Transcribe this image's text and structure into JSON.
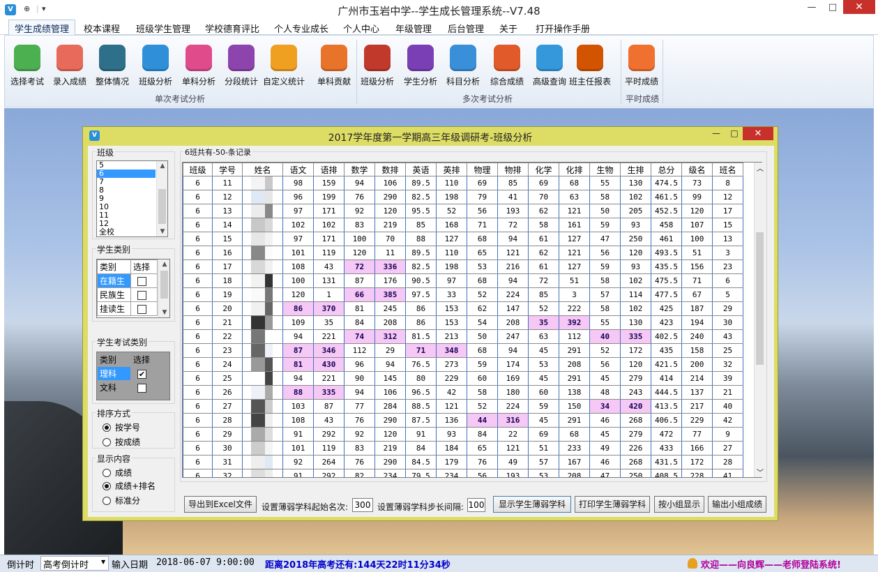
{
  "app": {
    "title": "广州市玉岩中学--学生成长管理系统--V7.48",
    "minimize": "—",
    "maximize": "□",
    "close": "✕",
    "quick_access": [
      "⊕",
      "▾"
    ]
  },
  "menu": [
    "学生成绩管理",
    "校本课程",
    "班级学生管理",
    "学校德育评比",
    "个人专业成长",
    "个人中心",
    "年级管理",
    "后台管理",
    "关于",
    "打开操作手册"
  ],
  "ribbon": {
    "groups": [
      "单次考试分析",
      "多次考试分析",
      "平时成绩"
    ],
    "buttons": [
      {
        "label": "选择考试",
        "color": "#4caf50",
        "icon": "download-icon"
      },
      {
        "label": "录入成绩",
        "color": "#e86a5a",
        "icon": "notepad-icon"
      },
      {
        "label": "整体情况",
        "color": "#2e6f8a",
        "icon": "layers-icon"
      },
      {
        "label": "班级分析",
        "color": "#2f8fd8",
        "icon": "line-chart-icon"
      },
      {
        "label": "单科分析",
        "color": "#e04b8b",
        "icon": "bookmark-icon"
      },
      {
        "label": "分段统计",
        "color": "#8e44ad",
        "icon": "palette-icon"
      },
      {
        "label": "自定义统计",
        "color": "#f0a020",
        "icon": "shield-icon"
      },
      {
        "label": "单科贡献",
        "color": "#e8732a",
        "icon": "compass-icon"
      },
      {
        "label": "班级分析",
        "color": "#c0392b",
        "icon": "book-icon"
      },
      {
        "label": "学生分析",
        "color": "#7b3fb5",
        "icon": "bar-chart-icon"
      },
      {
        "label": "科目分析",
        "color": "#3a8fd9",
        "icon": "list-icon"
      },
      {
        "label": "综合成绩",
        "color": "#e05a2a",
        "icon": "report-icon"
      },
      {
        "label": "高级查询",
        "color": "#3498db",
        "icon": "card-icon"
      },
      {
        "label": "班主任报表",
        "color": "#d35400",
        "icon": "briefcase-icon"
      },
      {
        "label": "平时成绩",
        "color": "#f07030",
        "icon": "document-icon"
      }
    ]
  },
  "window": {
    "title": "2017学年度第一学期高三年级调研考-班级分析",
    "record_info": "6班共有-50-条记录",
    "class_group": {
      "label": "班级",
      "items": [
        "5",
        "6",
        "7",
        "8",
        "9",
        "10",
        "11",
        "12",
        "全校"
      ],
      "selected": "6"
    },
    "student_type": {
      "label": "学生类别",
      "headers": [
        "类别",
        "选择"
      ],
      "rows": [
        {
          "name": "在籍生",
          "checked": false
        },
        {
          "name": "民族生",
          "checked": false
        },
        {
          "name": "挂读生",
          "checked": false
        }
      ]
    },
    "exam_type": {
      "label": "学生考试类别",
      "headers": [
        "类别",
        "选择"
      ],
      "rows": [
        {
          "name": "理科",
          "checked": true
        },
        {
          "name": "文科",
          "checked": false
        }
      ]
    },
    "sort": {
      "label": "排序方式",
      "options": [
        "按学号",
        "按成绩"
      ],
      "selected": 0
    },
    "display": {
      "label": "显示内容",
      "options": [
        "成绩",
        "成绩+排名",
        "标准分"
      ],
      "selected": 1
    },
    "table": {
      "headers": [
        "班级",
        "学号",
        "姓名",
        "语文",
        "语排",
        "数学",
        "数排",
        "英语",
        "英排",
        "物理",
        "物排",
        "化学",
        "化排",
        "生物",
        "生排",
        "总分",
        "级名",
        "班名"
      ],
      "rows": [
        [
          "6",
          "11",
          "",
          "98",
          "159",
          "94",
          "106",
          "89.5",
          "110",
          "69",
          "85",
          "69",
          "68",
          "55",
          "130",
          "474.5",
          "73",
          "8"
        ],
        [
          "6",
          "12",
          "",
          "96",
          "199",
          "76",
          "290",
          "82.5",
          "198",
          "79",
          "41",
          "70",
          "63",
          "58",
          "102",
          "461.5",
          "99",
          "12"
        ],
        [
          "6",
          "13",
          "",
          "97",
          "171",
          "92",
          "120",
          "95.5",
          "52",
          "56",
          "193",
          "62",
          "121",
          "50",
          "205",
          "452.5",
          "120",
          "17"
        ],
        [
          "6",
          "14",
          "",
          "102",
          "102",
          "83",
          "219",
          "85",
          "168",
          "71",
          "72",
          "58",
          "161",
          "59",
          "93",
          "458",
          "107",
          "15"
        ],
        [
          "6",
          "15",
          "",
          "97",
          "171",
          "100",
          "70",
          "88",
          "127",
          "68",
          "94",
          "61",
          "127",
          "47",
          "250",
          "461",
          "100",
          "13"
        ],
        [
          "6",
          "16",
          "",
          "101",
          "119",
          "120",
          "11",
          "89.5",
          "110",
          "65",
          "121",
          "62",
          "121",
          "56",
          "120",
          "493.5",
          "51",
          "3"
        ],
        [
          "6",
          "17",
          "",
          "108",
          "43",
          "72",
          "336",
          "82.5",
          "198",
          "53",
          "216",
          "61",
          "127",
          "59",
          "93",
          "435.5",
          "156",
          "23"
        ],
        [
          "6",
          "18",
          "",
          "100",
          "131",
          "87",
          "176",
          "90.5",
          "97",
          "68",
          "94",
          "72",
          "51",
          "58",
          "102",
          "475.5",
          "71",
          "6"
        ],
        [
          "6",
          "19",
          "",
          "120",
          "1",
          "66",
          "385",
          "97.5",
          "33",
          "52",
          "224",
          "85",
          "3",
          "57",
          "114",
          "477.5",
          "67",
          "5"
        ],
        [
          "6",
          "20",
          "",
          "86",
          "370",
          "81",
          "245",
          "86",
          "153",
          "62",
          "147",
          "52",
          "222",
          "58",
          "102",
          "425",
          "187",
          "29"
        ],
        [
          "6",
          "21",
          "",
          "109",
          "35",
          "84",
          "208",
          "86",
          "153",
          "54",
          "208",
          "35",
          "392",
          "55",
          "130",
          "423",
          "194",
          "30"
        ],
        [
          "6",
          "22",
          "",
          "94",
          "221",
          "74",
          "312",
          "81.5",
          "213",
          "50",
          "247",
          "63",
          "112",
          "40",
          "335",
          "402.5",
          "240",
          "43"
        ],
        [
          "6",
          "23",
          "",
          "87",
          "346",
          "112",
          "29",
          "71",
          "348",
          "68",
          "94",
          "45",
          "291",
          "52",
          "172",
          "435",
          "158",
          "25"
        ],
        [
          "6",
          "24",
          "",
          "81",
          "430",
          "96",
          "94",
          "76.5",
          "273",
          "59",
          "174",
          "53",
          "208",
          "56",
          "120",
          "421.5",
          "200",
          "32"
        ],
        [
          "6",
          "25",
          "",
          "94",
          "221",
          "90",
          "145",
          "80",
          "229",
          "60",
          "169",
          "45",
          "291",
          "45",
          "279",
          "414",
          "214",
          "39"
        ],
        [
          "6",
          "26",
          "",
          "88",
          "335",
          "94",
          "106",
          "96.5",
          "42",
          "58",
          "180",
          "60",
          "138",
          "48",
          "243",
          "444.5",
          "137",
          "21"
        ],
        [
          "6",
          "27",
          "",
          "103",
          "87",
          "77",
          "284",
          "88.5",
          "121",
          "52",
          "224",
          "59",
          "150",
          "34",
          "420",
          "413.5",
          "217",
          "40"
        ],
        [
          "6",
          "28",
          "",
          "108",
          "43",
          "76",
          "290",
          "87.5",
          "136",
          "44",
          "316",
          "45",
          "291",
          "46",
          "268",
          "406.5",
          "229",
          "42"
        ],
        [
          "6",
          "29",
          "",
          "91",
          "292",
          "92",
          "120",
          "91",
          "93",
          "84",
          "22",
          "69",
          "68",
          "45",
          "279",
          "472",
          "77",
          "9"
        ],
        [
          "6",
          "30",
          "",
          "101",
          "119",
          "83",
          "219",
          "84",
          "184",
          "65",
          "121",
          "51",
          "233",
          "49",
          "226",
          "433",
          "166",
          "27"
        ],
        [
          "6",
          "31",
          "",
          "92",
          "264",
          "76",
          "290",
          "84.5",
          "179",
          "76",
          "49",
          "57",
          "167",
          "46",
          "268",
          "431.5",
          "172",
          "28"
        ],
        [
          "6",
          "32",
          "",
          "91",
          "292",
          "82",
          "234",
          "79.5",
          "234",
          "56",
          "193",
          "53",
          "208",
          "47",
          "250",
          "408.5",
          "228",
          "41"
        ]
      ],
      "highlights": [
        [
          6,
          5
        ],
        [
          6,
          6
        ],
        [
          8,
          5
        ],
        [
          8,
          6
        ],
        [
          9,
          3
        ],
        [
          9,
          4
        ],
        [
          10,
          11
        ],
        [
          10,
          12
        ],
        [
          11,
          5
        ],
        [
          11,
          6
        ],
        [
          11,
          13
        ],
        [
          11,
          14
        ],
        [
          12,
          3
        ],
        [
          12,
          4
        ],
        [
          12,
          7
        ],
        [
          12,
          8
        ],
        [
          13,
          3
        ],
        [
          13,
          4
        ],
        [
          15,
          3
        ],
        [
          15,
          4
        ],
        [
          16,
          13
        ],
        [
          16,
          14
        ],
        [
          17,
          9
        ],
        [
          17,
          10
        ]
      ]
    },
    "bottom": {
      "export_btn": "导出到Excel文件",
      "start_label": "设置薄弱学科起始名次:",
      "start_value": "300",
      "step_label": "设置薄弱学科步长间隔:",
      "step_value": "100",
      "show_weak_btn": "显示学生薄弱学科",
      "print_weak_btn": "打印学生薄弱学科",
      "group_show_btn": "按小组显示",
      "group_export_btn": "输出小组成绩"
    }
  },
  "status": {
    "countdown_label": "倒计时",
    "countdown_select": "高考倒计时",
    "date_label": "输入日期",
    "date_value": "2018-06-07  9:00:00",
    "remaining": "距离2018年高考还有:144天22时11分34秒",
    "welcome": "欢迎——向良辉——老师登陆系统!"
  },
  "colors": {
    "highlight": "#f6c8f6",
    "window_border": "#dddd66",
    "selection": "#3399ff"
  }
}
